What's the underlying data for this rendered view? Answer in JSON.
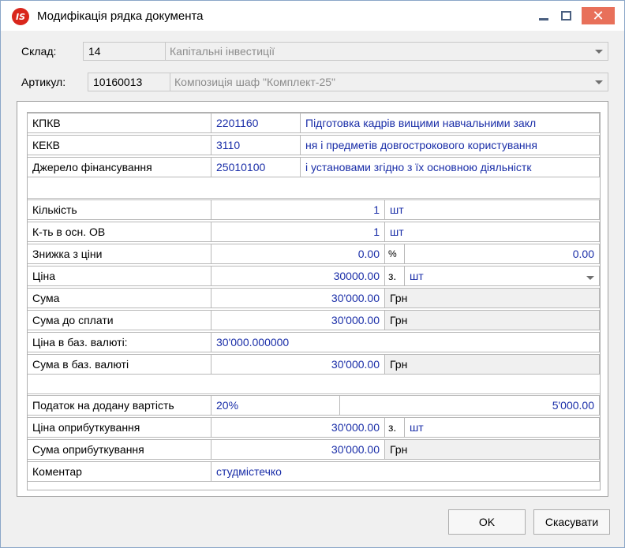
{
  "window": {
    "title": "Модифікація рядка документа",
    "app_icon_text": "IS",
    "accent_close": "#e8705a"
  },
  "sklad": {
    "label": "Склад:",
    "code": "14",
    "name": "Капітальні інвестиції"
  },
  "artykul": {
    "label": "Артикул:",
    "code": "10160013",
    "name": "Композиція шаф \"Комплект-25\""
  },
  "rows": {
    "kpkv": {
      "label": "КПКВ",
      "code": "2201160",
      "desc": "Підготовка кадрів вищими навчальними закл"
    },
    "kekv": {
      "label": "КЕКВ",
      "code": "3110",
      "desc": "ня і предметів довгострокового користування"
    },
    "dzherelo": {
      "label": "Джерело фінансування",
      "code": "25010100",
      "desc": "і установами згідно з їх основною діяльністк"
    },
    "kilkist": {
      "label": "Кількість",
      "value": "1",
      "unit": "шт"
    },
    "kt_osn": {
      "label": "К-ть в осн. ОВ",
      "value": "1",
      "unit": "шт"
    },
    "znyzhka": {
      "label": "Знижка з ціни",
      "value": "0.00",
      "unit": "%",
      "value2": "0.00"
    },
    "tsina": {
      "label": "Ціна",
      "value": "30000.00",
      "per": "з.",
      "unit": "шт"
    },
    "suma": {
      "label": "Сума",
      "value": "30'000.00",
      "unit": "Грн"
    },
    "suma_splaty": {
      "label": "Сума до сплати",
      "value": "30'000.00",
      "unit": "Грн"
    },
    "tsina_baz": {
      "label": "Ціна в баз. валюті:",
      "value": "30'000.000000"
    },
    "suma_baz": {
      "label": "Сума в баз. валюті",
      "value": "30'000.00",
      "unit": "Грн"
    },
    "pdv": {
      "label": "Податок на додану вартість",
      "rate": "20%",
      "amount": "5'000.00"
    },
    "tsina_opryb": {
      "label": "Ціна оприбуткування",
      "value": "30'000.00",
      "per": "з.",
      "unit": "шт"
    },
    "suma_opryb": {
      "label": "Сума оприбуткування",
      "value": "30'000.00",
      "unit": "Грн"
    },
    "komentar": {
      "label": "Коментар",
      "value": "студмістечко"
    }
  },
  "buttons": {
    "ok": "OK",
    "cancel": "Скасувати"
  }
}
